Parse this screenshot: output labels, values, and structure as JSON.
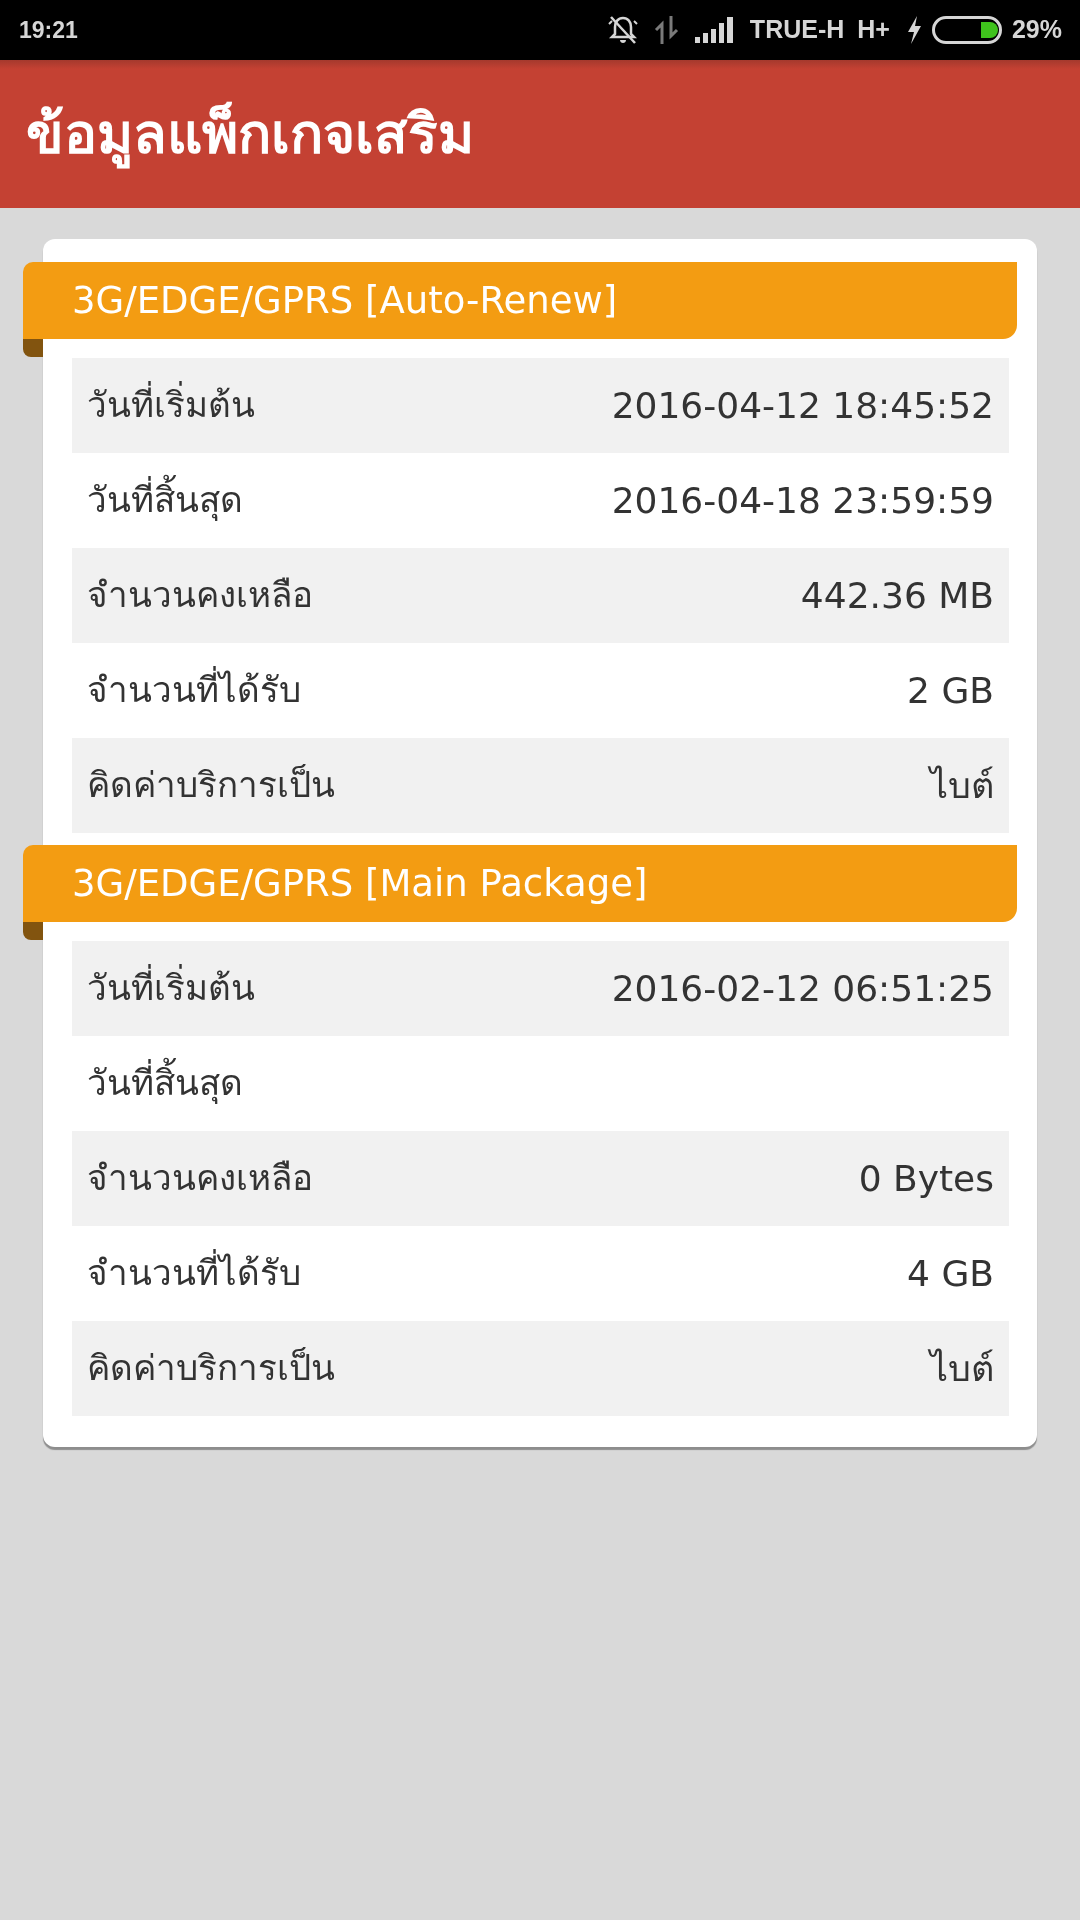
{
  "status_bar": {
    "time": "19:21",
    "carrier": "TRUE-H",
    "network": "H+",
    "battery": "29%"
  },
  "header": {
    "title": "ข้อมูลแพ็กเกจเสริม"
  },
  "packages": [
    {
      "title": "3G/EDGE/GPRS [Auto-Renew]",
      "rows": [
        {
          "label": "วันที่เริ่มต้น",
          "value": "2016-04-12 18:45:52"
        },
        {
          "label": "วันที่สิ้นสุด",
          "value": "2016-04-18 23:59:59"
        },
        {
          "label": "จำนวนคงเหลือ",
          "value": "442.36 MB"
        },
        {
          "label": "จำนวนที่ได้รับ",
          "value": "2 GB"
        },
        {
          "label": "คิดค่าบริการเป็น",
          "value": "ไบต์"
        }
      ]
    },
    {
      "title": "3G/EDGE/GPRS [Main Package]",
      "rows": [
        {
          "label": "วันที่เริ่มต้น",
          "value": "2016-02-12 06:51:25"
        },
        {
          "label": "วันที่สิ้นสุด"
        },
        {
          "label": "จำนวนคงเหลือ",
          "value": "0 Bytes"
        },
        {
          "label": "จำนวนที่ได้รับ",
          "value": "4 GB"
        },
        {
          "label": "คิดค่าบริการเป็น",
          "value": "ไบต์"
        }
      ]
    }
  ]
}
